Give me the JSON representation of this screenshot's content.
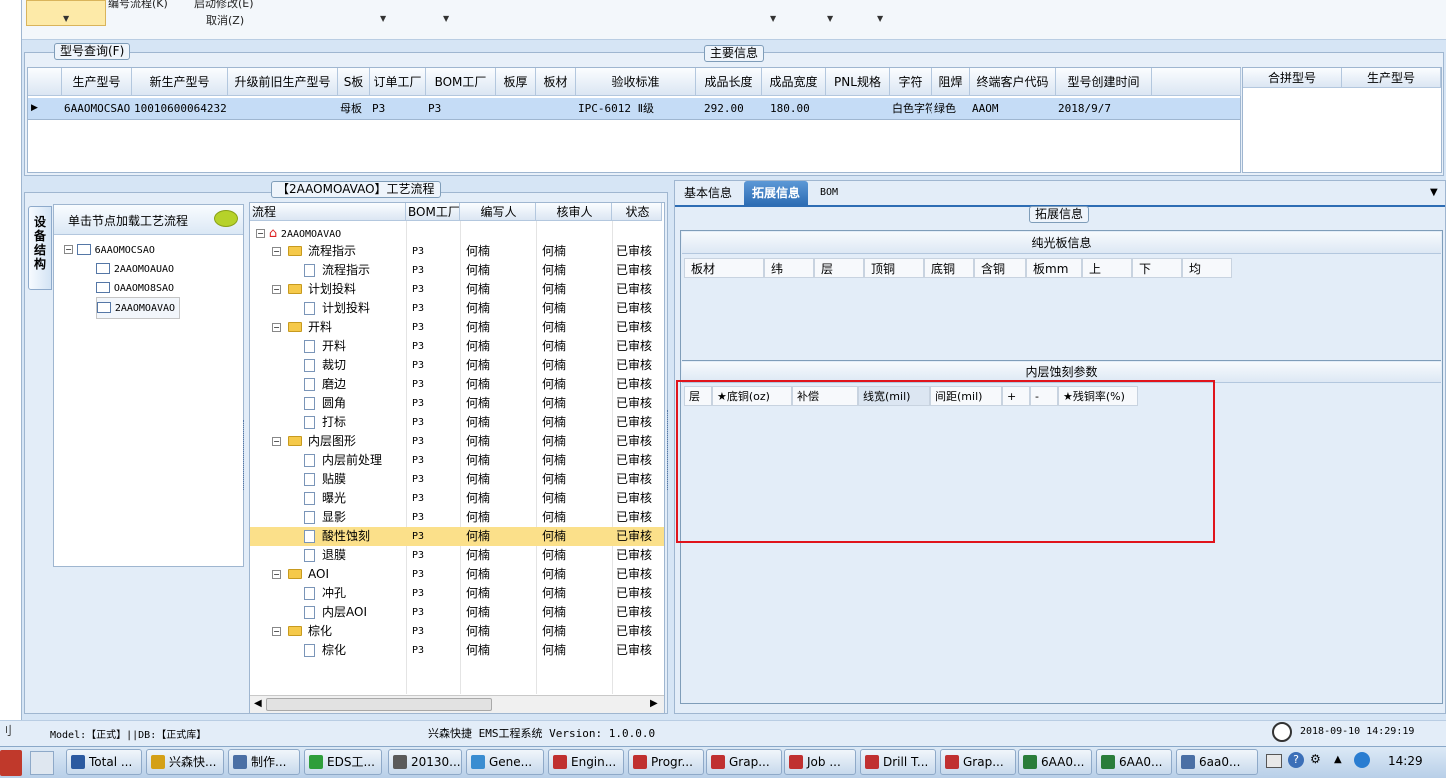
{
  "toolbar": {
    "menu1": "编号流程(K)",
    "menu2": "启动修改(E)",
    "cancel": "取消(Z)"
  },
  "model_group": {
    "legend": "型号查询(F)",
    "main_legend": "主要信息"
  },
  "main_grid": {
    "headers": [
      "生产型号",
      "新生产型号",
      "升级前旧生产型号",
      "S板",
      "订单工厂",
      "BOM工厂",
      "板厚",
      "板材",
      "验收标准",
      "成品长度",
      "成品宽度",
      "PNL规格",
      "字符",
      "阻焊",
      "终端客户代码",
      "型号创建时间"
    ],
    "row": {
      "c0": "6AAOMOCSAO",
      "c1": "10010600064232",
      "c3": "母板",
      "c4": "P3",
      "c5": "P3",
      "c8": "IPC-6012 Ⅱ级",
      "c9": "292.00",
      "c10": "180.00",
      "c12": "白色字符",
      "c13": "绿色",
      "c14": "AAOM",
      "c15": "2018/9/7"
    },
    "side_headers": [
      "合拼型号",
      "生产型号"
    ]
  },
  "left_panel": {
    "vtab": "设备结构",
    "header": "单击节点加载工艺流程",
    "tree": [
      "6AAOMOCSAO",
      "2AAOMOAUAO",
      "OAAOMO8SAO",
      "2AAOMOAVAO"
    ]
  },
  "process": {
    "legend": "【2AAOMOAVAO】工艺流程",
    "headers": [
      "流程",
      "BOM工厂",
      "编写人",
      "核审人",
      "状态"
    ],
    "root": "2AAOMOAVAO",
    "rows": [
      {
        "name": "流程指示",
        "lvl": 1,
        "type": "folder",
        "bom": "P3",
        "w": "何楠",
        "r": "何楠",
        "s": "已审核"
      },
      {
        "name": "流程指示",
        "lvl": 2,
        "type": "doc",
        "bom": "P3",
        "w": "何楠",
        "r": "何楠",
        "s": "已审核"
      },
      {
        "name": "计划投料",
        "lvl": 1,
        "type": "folder",
        "bom": "P3",
        "w": "何楠",
        "r": "何楠",
        "s": "已审核"
      },
      {
        "name": "计划投料",
        "lvl": 2,
        "type": "doc",
        "bom": "P3",
        "w": "何楠",
        "r": "何楠",
        "s": "已审核"
      },
      {
        "name": "开料",
        "lvl": 1,
        "type": "folder",
        "bom": "P3",
        "w": "何楠",
        "r": "何楠",
        "s": "已审核"
      },
      {
        "name": "开料",
        "lvl": 2,
        "type": "doc",
        "bom": "P3",
        "w": "何楠",
        "r": "何楠",
        "s": "已审核"
      },
      {
        "name": "裁切",
        "lvl": 2,
        "type": "doc",
        "bom": "P3",
        "w": "何楠",
        "r": "何楠",
        "s": "已审核"
      },
      {
        "name": "磨边",
        "lvl": 2,
        "type": "doc",
        "bom": "P3",
        "w": "何楠",
        "r": "何楠",
        "s": "已审核"
      },
      {
        "name": "圆角",
        "lvl": 2,
        "type": "doc",
        "bom": "P3",
        "w": "何楠",
        "r": "何楠",
        "s": "已审核"
      },
      {
        "name": "打标",
        "lvl": 2,
        "type": "doc",
        "bom": "P3",
        "w": "何楠",
        "r": "何楠",
        "s": "已审核"
      },
      {
        "name": "内层图形",
        "lvl": 1,
        "type": "folder",
        "bom": "P3",
        "w": "何楠",
        "r": "何楠",
        "s": "已审核"
      },
      {
        "name": "内层前处理",
        "lvl": 2,
        "type": "doc",
        "bom": "P3",
        "w": "何楠",
        "r": "何楠",
        "s": "已审核"
      },
      {
        "name": "贴膜",
        "lvl": 2,
        "type": "doc",
        "bom": "P3",
        "w": "何楠",
        "r": "何楠",
        "s": "已审核"
      },
      {
        "name": "曝光",
        "lvl": 2,
        "type": "doc",
        "bom": "P3",
        "w": "何楠",
        "r": "何楠",
        "s": "已审核"
      },
      {
        "name": "显影",
        "lvl": 2,
        "type": "doc",
        "bom": "P3",
        "w": "何楠",
        "r": "何楠",
        "s": "已审核"
      },
      {
        "name": "酸性蚀刻",
        "lvl": 2,
        "type": "doc",
        "bom": "P3",
        "w": "何楠",
        "r": "何楠",
        "s": "已审核",
        "sel": true
      },
      {
        "name": "退膜",
        "lvl": 2,
        "type": "doc",
        "bom": "P3",
        "w": "何楠",
        "r": "何楠",
        "s": "已审核"
      },
      {
        "name": "AOI",
        "lvl": 1,
        "type": "folder",
        "bom": "P3",
        "w": "何楠",
        "r": "何楠",
        "s": "已审核"
      },
      {
        "name": "冲孔",
        "lvl": 2,
        "type": "doc",
        "bom": "P3",
        "w": "何楠",
        "r": "何楠",
        "s": "已审核"
      },
      {
        "name": "内层AOI",
        "lvl": 2,
        "type": "doc",
        "bom": "P3",
        "w": "何楠",
        "r": "何楠",
        "s": "已审核"
      },
      {
        "name": "棕化",
        "lvl": 1,
        "type": "folder",
        "bom": "P3",
        "w": "何楠",
        "r": "何楠",
        "s": "已审核"
      },
      {
        "name": "棕化",
        "lvl": 2,
        "type": "doc",
        "bom": "P3",
        "w": "何楠",
        "r": "何楠",
        "s": "已审核"
      }
    ]
  },
  "right_panel": {
    "tabs": [
      "基本信息",
      "拓展信息",
      "BOM"
    ],
    "legend": "拓展信息",
    "board_title": "纯光板信息",
    "board_headers": [
      "板材",
      "纬",
      "层",
      "顶铜",
      "底铜",
      "含铜",
      "板mm",
      "上",
      "下",
      "均"
    ],
    "etch_title": "内层蚀刻参数",
    "etch_headers": [
      "层",
      "★底铜(oz)",
      "补偿",
      "线宽(mil)",
      "间距(mil)",
      "+",
      "-",
      "★残铜率(%)"
    ]
  },
  "status": {
    "left": "Model:【正式】||DB:【正式库】",
    "center": "兴森快捷 EMS工程系统 Version: 1.0.0.0",
    "time": "2018-09-10 14:29:19"
  },
  "taskbar": {
    "items": [
      "Total ...",
      "兴森快...",
      "制作...",
      "EDS工...",
      "20130...",
      "Gene...",
      "Engin...",
      "Progr...",
      "Grap...",
      "Job ...",
      "Drill T...",
      "Grap...",
      "6AA0...",
      "6AA0...",
      "6aa0..."
    ],
    "clock": "14:29"
  }
}
